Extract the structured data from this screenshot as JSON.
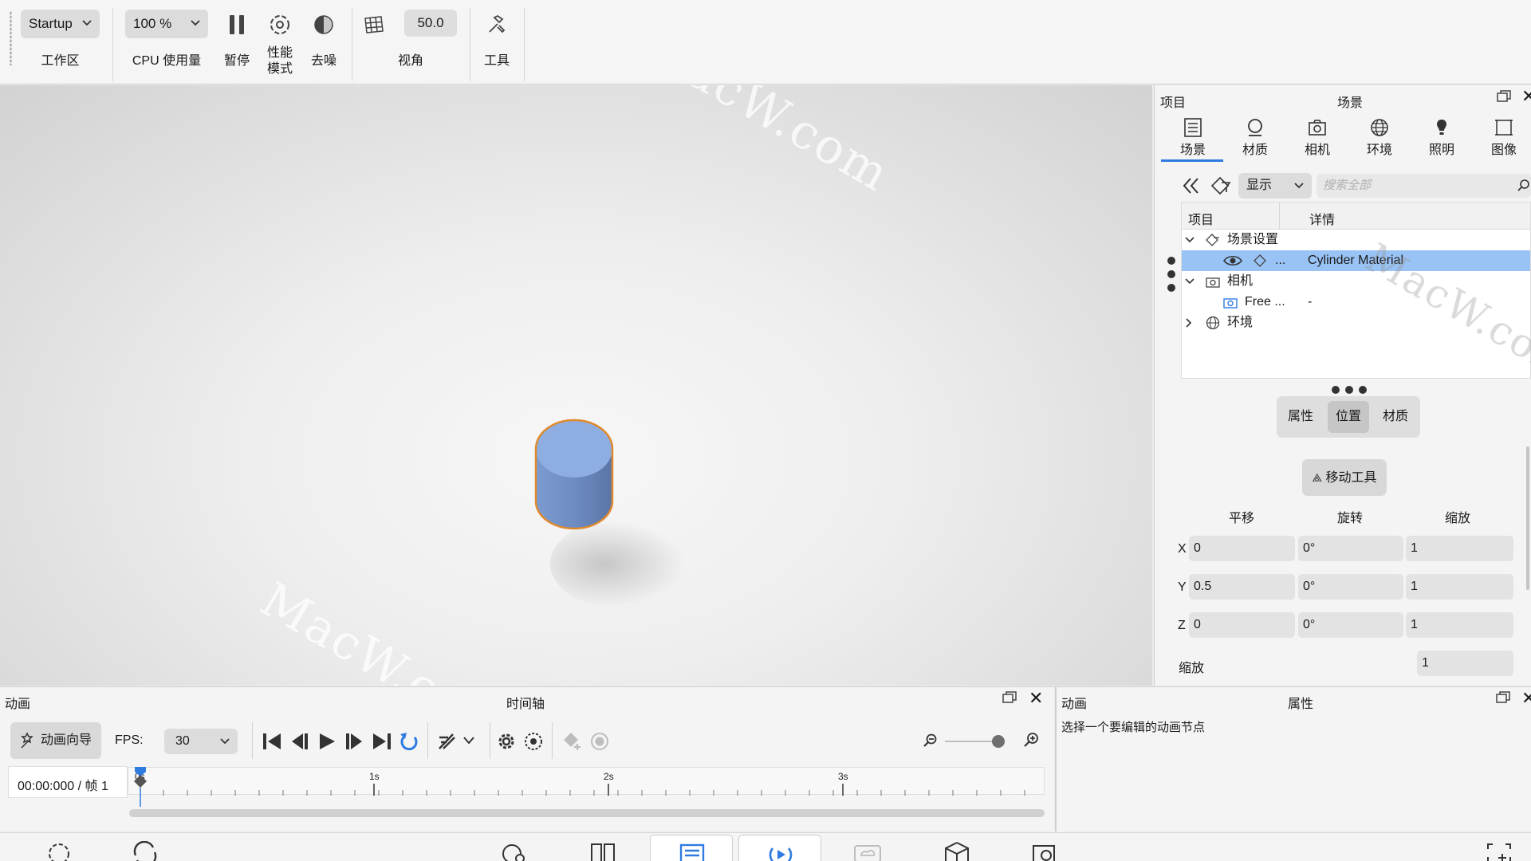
{
  "toolbar": {
    "workspace_value": "Startup",
    "workspace_label": "工作区",
    "cpu_value": "100 %",
    "cpu_label": "CPU 使用量",
    "pause_label": "暂停",
    "perf_label_1": "性能",
    "perf_label_2": "模式",
    "denoise_label": "去噪",
    "fov_value": "50.0",
    "fov_label": "视角",
    "tools_label": "工具"
  },
  "viewport": {
    "watermark_1": "MacW.com",
    "watermark_2": "MacW.com",
    "watermark_3": "MacW.com"
  },
  "right_panel": {
    "header_left": "项目",
    "header_center": "场景",
    "tabs": [
      {
        "label": "场景",
        "icon": "list-icon"
      },
      {
        "label": "材质",
        "icon": "material-icon"
      },
      {
        "label": "相机",
        "icon": "camera-icon"
      },
      {
        "label": "环境",
        "icon": "globe-icon"
      },
      {
        "label": "照明",
        "icon": "bulb-icon"
      },
      {
        "label": "图像",
        "icon": "image-icon"
      }
    ],
    "filter_value": "显示",
    "search_placeholder": "搜索全部",
    "tree_columns": {
      "item": "项目",
      "detail": "详情"
    },
    "tree": [
      {
        "label": "场景设置",
        "detail": ""
      },
      {
        "label": "...",
        "detail": "Cylinder Material"
      },
      {
        "label": "相机",
        "detail": ""
      },
      {
        "label": "Free ...",
        "detail": "-"
      },
      {
        "label": "环境",
        "detail": ""
      }
    ],
    "segments": [
      "属性",
      "位置",
      "材质"
    ],
    "move_tool_label": "移动工具",
    "transform_headers": [
      "平移",
      "旋转",
      "缩放"
    ],
    "rows": [
      {
        "axis": "X",
        "translate": "0",
        "rotate": "0°",
        "scale": "1"
      },
      {
        "axis": "Y",
        "translate": "0.5",
        "rotate": "0°",
        "scale": "1"
      },
      {
        "axis": "Z",
        "translate": "0",
        "rotate": "0°",
        "scale": "1"
      }
    ],
    "uniform_scale_label": "缩放",
    "uniform_scale_value": "1",
    "watermark": "MacW.com"
  },
  "animation_panel": {
    "title_left": "动画",
    "title_center": "时间轴",
    "wizard_label": "动画向导",
    "fps_label": "FPS:",
    "fps_value": "30",
    "timecode": "00:00:000 / 帧 1",
    "ruler": [
      "0s",
      "1s",
      "2s",
      "3s"
    ]
  },
  "props_panel": {
    "title_left": "动画",
    "title_center": "属性",
    "hint": "选择一个要编辑的动画节点"
  },
  "colors": {
    "accent": "#2f7be0",
    "selection": "#99c3f5",
    "cylinder": "#7f9fd0",
    "outline": "#e08a2e"
  }
}
